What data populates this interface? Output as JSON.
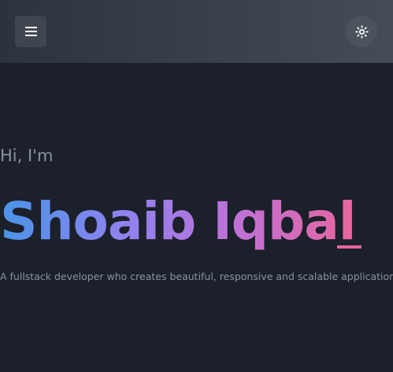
{
  "header": {
    "menu_icon": "hamburger-menu-icon",
    "theme_icon": "sun-icon"
  },
  "hero": {
    "greeting": "Hi, I'm",
    "name": "Shoaib Iqbal",
    "tagline": "A fullstack developer who creates beautiful, responsive and scalable applications."
  },
  "colors": {
    "background": "#1b202b",
    "gradient_start": "#4a95e8",
    "gradient_mid": "#bd72d8",
    "gradient_end": "#e8669e"
  }
}
